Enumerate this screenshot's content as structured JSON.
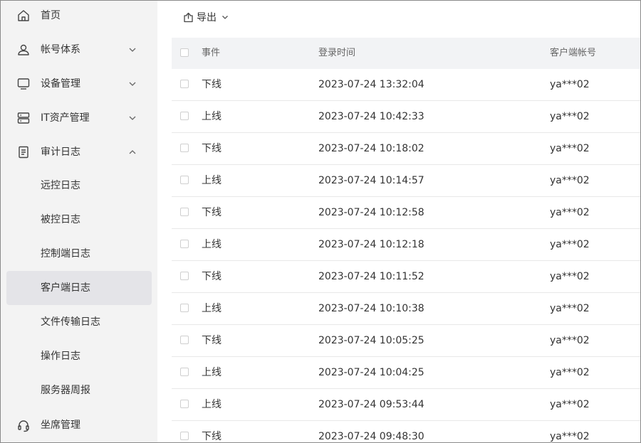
{
  "sidebar": {
    "items": [
      {
        "label": "首页",
        "icon": "home-icon"
      },
      {
        "label": "帐号体系",
        "icon": "user-icon",
        "expandable": true,
        "expanded": false
      },
      {
        "label": "设备管理",
        "icon": "monitor-icon",
        "expandable": true,
        "expanded": false
      },
      {
        "label": "IT资产管理",
        "icon": "server-icon",
        "expandable": true,
        "expanded": false
      },
      {
        "label": "审计日志",
        "icon": "document-icon",
        "expandable": true,
        "expanded": true
      },
      {
        "label": "坐席管理",
        "icon": "headset-icon"
      }
    ],
    "audit_subitems": [
      {
        "label": "远控日志"
      },
      {
        "label": "被控日志"
      },
      {
        "label": "控制端日志"
      },
      {
        "label": "客户端日志",
        "active": true
      },
      {
        "label": "文件传输日志"
      },
      {
        "label": "操作日志"
      },
      {
        "label": "服务器周报"
      }
    ]
  },
  "toolbar": {
    "export_label": "导出"
  },
  "table": {
    "columns": [
      "事件",
      "登录时间",
      "客户端帐号"
    ],
    "rows": [
      {
        "event": "下线",
        "time": "2023-07-24 13:32:04",
        "account": "ya***02"
      },
      {
        "event": "上线",
        "time": "2023-07-24 10:42:33",
        "account": "ya***02"
      },
      {
        "event": "下线",
        "time": "2023-07-24 10:18:02",
        "account": "ya***02"
      },
      {
        "event": "上线",
        "time": "2023-07-24 10:14:57",
        "account": "ya***02"
      },
      {
        "event": "下线",
        "time": "2023-07-24 10:12:58",
        "account": "ya***02"
      },
      {
        "event": "上线",
        "time": "2023-07-24 10:12:18",
        "account": "ya***02"
      },
      {
        "event": "下线",
        "time": "2023-07-24 10:11:52",
        "account": "ya***02"
      },
      {
        "event": "上线",
        "time": "2023-07-24 10:10:38",
        "account": "ya***02"
      },
      {
        "event": "下线",
        "time": "2023-07-24 10:05:25",
        "account": "ya***02"
      },
      {
        "event": "上线",
        "time": "2023-07-24 10:04:25",
        "account": "ya***02"
      },
      {
        "event": "上线",
        "time": "2023-07-24 09:53:44",
        "account": "ya***02"
      },
      {
        "event": "下线",
        "time": "2023-07-24 09:48:30",
        "account": "ya***02"
      }
    ]
  },
  "colors": {
    "sidebar_bg": "#f3f3f3",
    "active_item_bg": "#e4e4e8",
    "table_header_bg": "#f2f3f5",
    "row_border": "#e8e8e8"
  }
}
